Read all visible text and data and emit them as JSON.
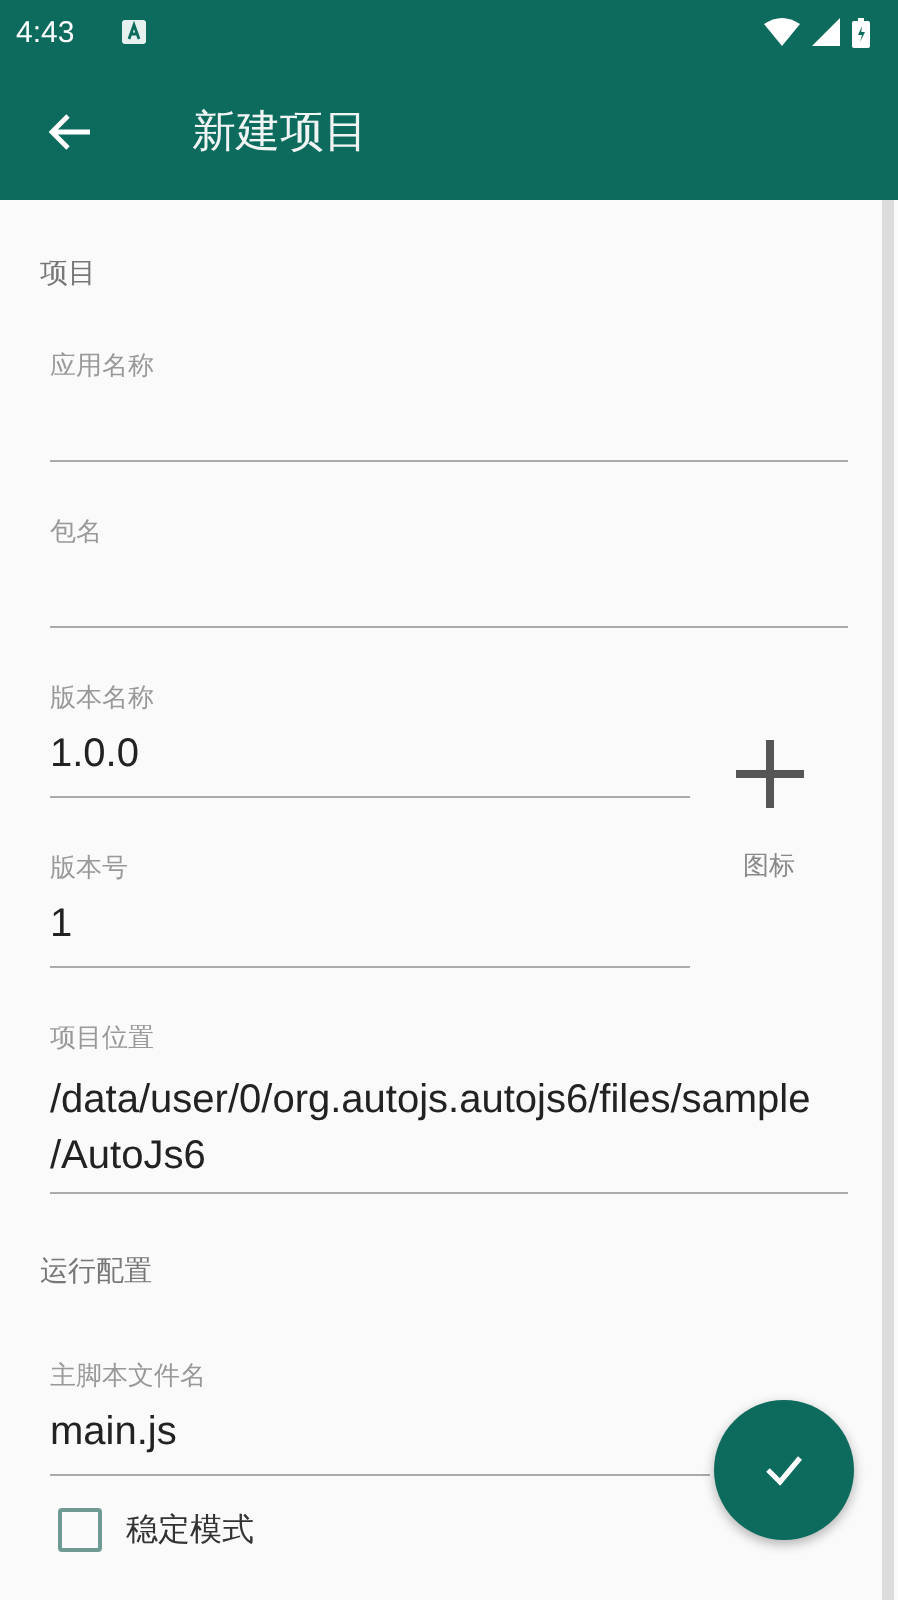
{
  "status_bar": {
    "time": "4:43"
  },
  "toolbar": {
    "title": "新建项目"
  },
  "project": {
    "heading": "项目",
    "app_name": {
      "label": "应用名称"
    },
    "package_name": {
      "label": "包名"
    },
    "version_name": {
      "label": "版本名称",
      "value": "1.0.0"
    },
    "version_code": {
      "label": "版本号",
      "value": "1"
    },
    "icon": {
      "label": "图标"
    },
    "location": {
      "label": "项目位置",
      "value": "/data/user/0/org.autojs.autojs6/files/sample/AutoJs6"
    }
  },
  "run_config": {
    "heading": "运行配置",
    "main_script": {
      "label": "主脚本文件名",
      "value": "main.js"
    },
    "stable_mode": {
      "label": "稳定模式",
      "checked": false
    }
  }
}
